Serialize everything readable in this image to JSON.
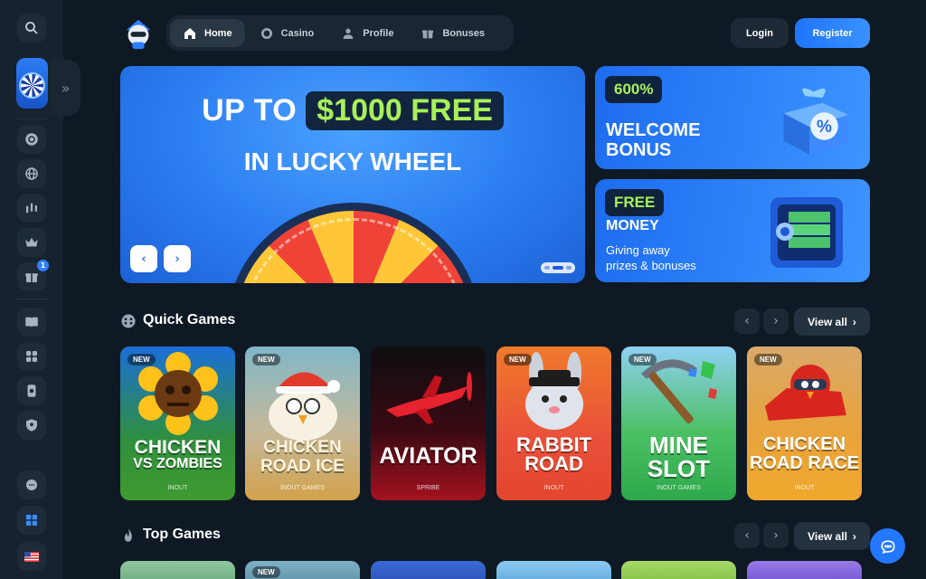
{
  "header": {
    "nav": [
      {
        "label": "Home",
        "icon": "home-icon",
        "active": true
      },
      {
        "label": "Casino",
        "icon": "chip-icon",
        "active": false
      },
      {
        "label": "Profile",
        "icon": "user-icon",
        "active": false
      },
      {
        "label": "Bonuses",
        "icon": "gift-icon",
        "active": false
      }
    ],
    "login_label": "Login",
    "register_label": "Register"
  },
  "sidebar": {
    "badge_count": "1",
    "icons": [
      "search-icon",
      "casino-chip-icon",
      "globe-icon",
      "chart-icon",
      "crown-icon",
      "gift-icon",
      "book-icon",
      "puzzle-icon",
      "tower-icon",
      "shield-icon",
      "chat-bubbles-icon",
      "windows-icon",
      "us-flag-icon"
    ]
  },
  "hero": {
    "line1_prefix": "UP TO",
    "line1_amount": "$1000 FREE",
    "line2": "IN LUCKY WHEEL",
    "prev_arrow": "‹",
    "next_arrow": "›"
  },
  "promos": [
    {
      "badge": "600%",
      "title_line1": "WELCOME",
      "title_line2": "BONUS",
      "subtitle_line1": "",
      "subtitle_line2": ""
    },
    {
      "badge": "FREE",
      "title_line1": "MONEY",
      "title_line2": "",
      "subtitle_line1": "Giving away",
      "subtitle_line2": "prizes & bonuses"
    }
  ],
  "quick_games": {
    "title": "Quick Games",
    "view_all": "View all",
    "games": [
      {
        "new": "NEW",
        "title_line1": "CHICKEN",
        "title_line2": "VS ZOMBIES",
        "provider": "INOUT"
      },
      {
        "new": "NEW",
        "title_line1": "CHICKEN",
        "title_line2": "ROAD ICE",
        "provider": "INOUT GAMES"
      },
      {
        "new": "",
        "title_line1": "AVIATOR",
        "title_line2": "",
        "provider": "SPRIBE"
      },
      {
        "new": "NEW",
        "title_line1": "RABBIT",
        "title_line2": "ROAD",
        "provider": "INOUT"
      },
      {
        "new": "NEW",
        "title_line1": "MINE",
        "title_line2": "SLOT",
        "provider": "INOUT GAMES"
      },
      {
        "new": "NEW",
        "title_line1": "CHICKEN",
        "title_line2": "ROAD RACE",
        "provider": "INOUT"
      }
    ]
  },
  "top_games": {
    "title": "Top Games",
    "view_all": "View all",
    "new_label": "NEW"
  },
  "colors": {
    "background": "#0f1923",
    "accent": "#2478ff",
    "highlight_green": "#a8f05a"
  }
}
